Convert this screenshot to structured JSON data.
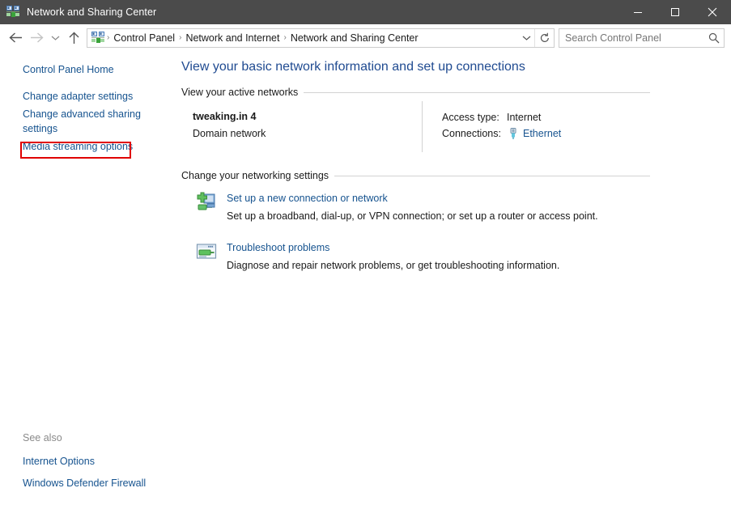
{
  "window": {
    "title": "Network and Sharing Center",
    "icon": "network-icon",
    "controls": {
      "minimize": "minimize-icon",
      "maximize": "maximize-icon",
      "close": "close-icon"
    }
  },
  "navbar": {
    "back": "back-arrow-icon",
    "forward": "forward-arrow-icon",
    "recent": "chevron-down-icon",
    "up": "up-arrow-icon",
    "breadcrumb_icon": "network-icon",
    "breadcrumbs": [
      "Control Panel",
      "Network and Internet",
      "Network and Sharing Center"
    ],
    "separator": "›",
    "address_chevron": "chevron-down-icon",
    "refresh": "refresh-icon"
  },
  "search": {
    "placeholder": "Search Control Panel",
    "icon": "search-icon"
  },
  "sidebar": {
    "items": [
      {
        "label": "Control Panel Home",
        "highlighted": false
      },
      {
        "label": "Change adapter settings",
        "highlighted": true
      },
      {
        "label": "Change advanced sharing settings",
        "highlighted": false
      },
      {
        "label": "Media streaming options",
        "highlighted": false
      }
    ],
    "highlight_color": "#e00000",
    "see_also": {
      "title": "See also",
      "items": [
        "Internet Options",
        "Windows Defender Firewall"
      ]
    }
  },
  "main": {
    "page_title": "View your basic network information and set up connections",
    "sections": [
      {
        "heading": "View your active networks"
      },
      {
        "heading": "Change your networking settings"
      }
    ],
    "active_network": {
      "name": "tweaking.in 4",
      "type": "Domain network",
      "access_type_label": "Access type:",
      "access_type_value": "Internet",
      "connections_label": "Connections:",
      "connections_icon": "ethernet-icon",
      "connections_value": "Ethernet"
    },
    "settings": [
      {
        "icon": "new-connection-icon",
        "title": "Set up a new connection or network",
        "description": "Set up a broadband, dial-up, or VPN connection; or set up a router or access point."
      },
      {
        "icon": "troubleshoot-icon",
        "title": "Troubleshoot problems",
        "description": "Diagnose and repair network problems, or get troubleshooting information."
      }
    ]
  },
  "colors": {
    "titlebar_bg": "#4b4b4b",
    "link": "#16538f",
    "heading": "#204b91",
    "highlight": "#e00000"
  }
}
